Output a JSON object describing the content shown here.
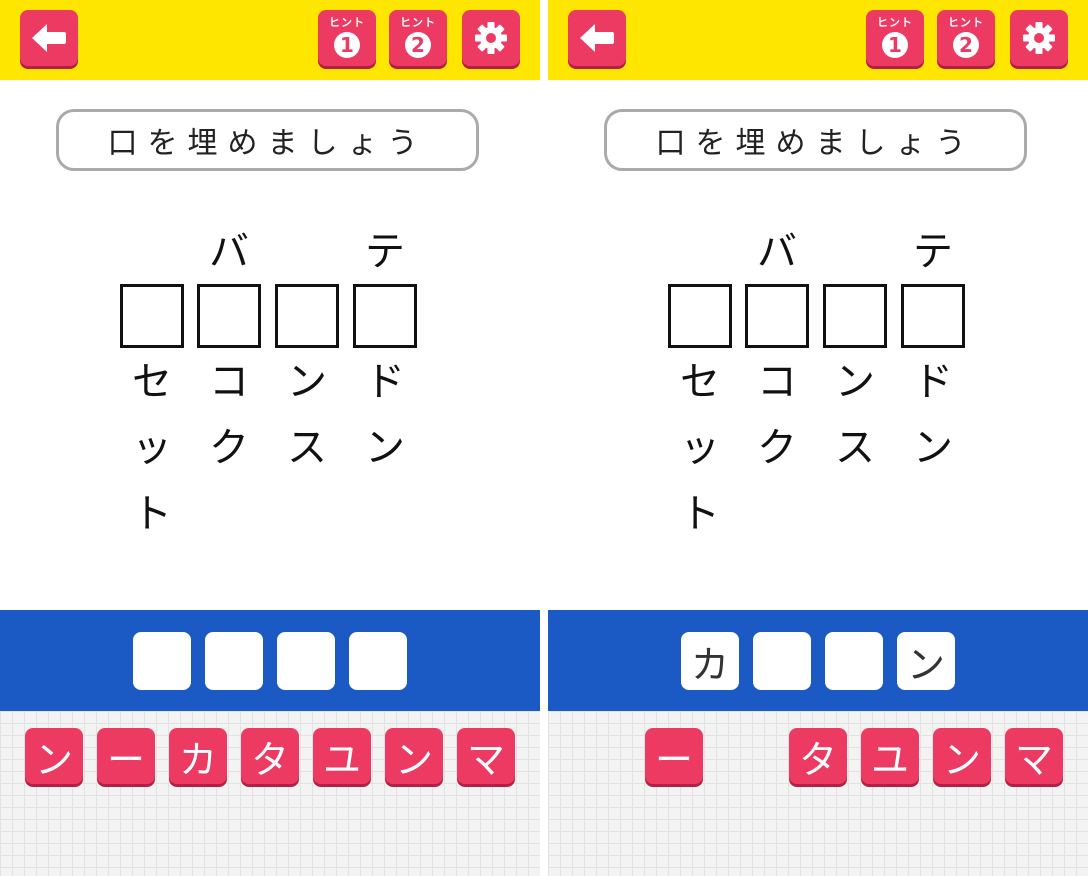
{
  "screens": [
    {
      "hints": [
        {
          "label": "ヒント",
          "number": "1"
        },
        {
          "label": "ヒント",
          "number": "2"
        }
      ],
      "instruction": "口を埋めましょう",
      "above": [
        "",
        "バ",
        "",
        "テ"
      ],
      "below": [
        [
          "セ",
          "ッ",
          "ト"
        ],
        [
          "コ",
          "ク"
        ],
        [
          "ン",
          "ス"
        ],
        [
          "ド",
          "ン"
        ]
      ],
      "answer_slots": [
        "",
        "",
        "",
        ""
      ],
      "keys": [
        "ン",
        "ー",
        "カ",
        "タ",
        "ユ",
        "ン",
        "マ"
      ]
    },
    {
      "hints": [
        {
          "label": "ヒント",
          "number": "1"
        },
        {
          "label": "ヒント",
          "number": "2"
        }
      ],
      "instruction": "口を埋めましょう",
      "above": [
        "",
        "バ",
        "",
        "テ"
      ],
      "below": [
        [
          "セ",
          "ッ",
          "ト"
        ],
        [
          "コ",
          "ク"
        ],
        [
          "ン",
          "ス"
        ],
        [
          "ド",
          "ン"
        ]
      ],
      "answer_slots": [
        "カ",
        "",
        "",
        "ン"
      ],
      "keys": [
        "",
        "ー",
        "",
        "タ",
        "ユ",
        "ン",
        "マ"
      ]
    }
  ],
  "colors": {
    "topbar": "#ffe600",
    "button": "#ec3a63",
    "answer_bar": "#1b5ac4"
  },
  "icons": {
    "back": "arrow-left-icon",
    "settings": "gear-icon"
  }
}
